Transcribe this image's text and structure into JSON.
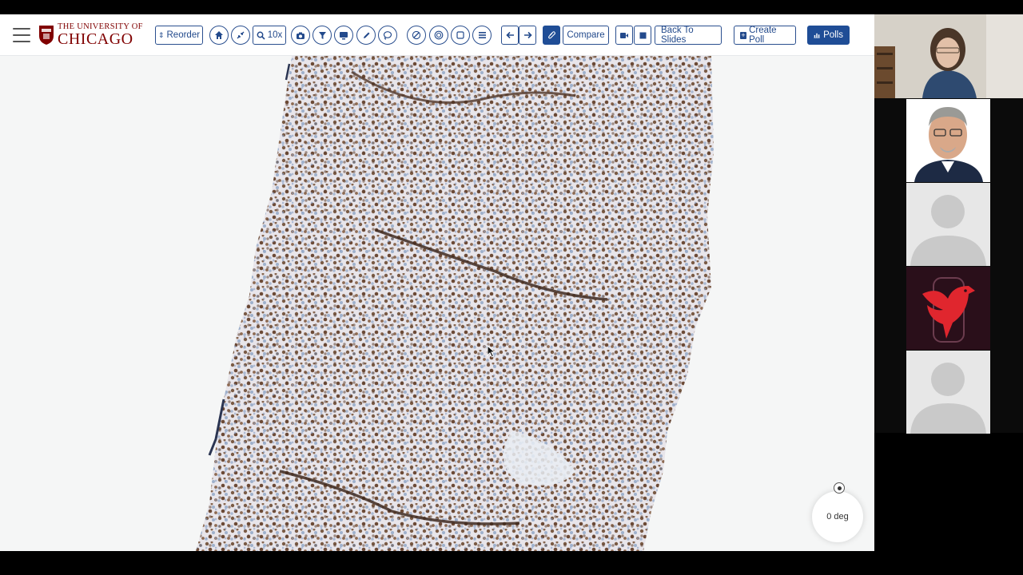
{
  "app": {
    "logo": {
      "line1": "THE UNIVERSITY OF",
      "line2": "CHICAGO"
    },
    "toolbar": {
      "reorder": "Reorder",
      "zoom": "10x",
      "compare": "Compare",
      "back_to_slides": "Back To Slides",
      "create_poll": "Create Poll",
      "polls": "Polls"
    },
    "accent_color": "#1f4d96",
    "brand_color": "#800000"
  },
  "viewer": {
    "rotation_label": "0 deg"
  },
  "video_panel": {
    "participants": [
      "presenter-video",
      "participant-video",
      "placeholder-avatar",
      "logo-avatar",
      "placeholder-avatar"
    ]
  }
}
